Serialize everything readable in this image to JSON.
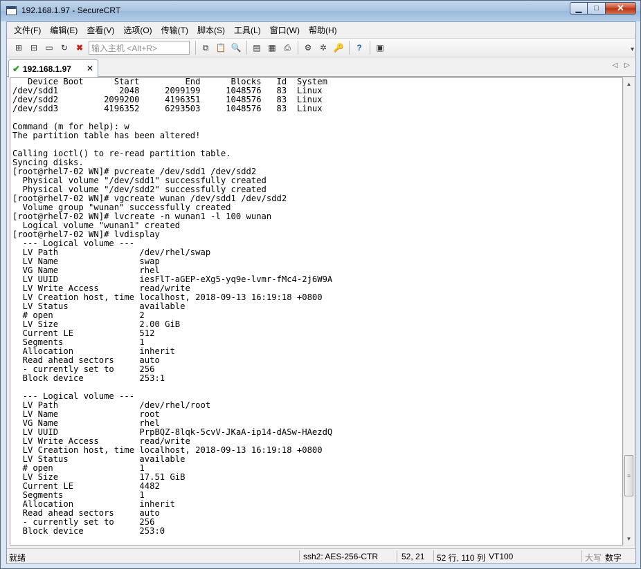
{
  "window": {
    "title": "192.168.1.97 - SecureCRT"
  },
  "menu": [
    "文件(F)",
    "编辑(E)",
    "查看(V)",
    "选项(O)",
    "传输(T)",
    "脚本(S)",
    "工具(L)",
    "窗口(W)",
    "帮助(H)"
  ],
  "toolbar": {
    "host_input_placeholder": "输入主机 <Alt+R>"
  },
  "tab": {
    "label": "192.168.1.97",
    "status": "connected"
  },
  "terminal": {
    "lines": [
      "   Device Boot      Start         End      Blocks   Id  System",
      "/dev/sdd1            2048     2099199     1048576   83  Linux",
      "/dev/sdd2         2099200     4196351     1048576   83  Linux",
      "/dev/sdd3         4196352     6293503     1048576   83  Linux",
      "",
      "Command (m for help): w",
      "The partition table has been altered!",
      "",
      "Calling ioctl() to re-read partition table.",
      "Syncing disks.",
      "[root@rhel7-02 WN]# pvcreate /dev/sdd1 /dev/sdd2",
      "  Physical volume \"/dev/sdd1\" successfully created",
      "  Physical volume \"/dev/sdd2\" successfully created",
      "[root@rhel7-02 WN]# vgcreate wunan /dev/sdd1 /dev/sdd2",
      "  Volume group \"wunan\" successfully created",
      "[root@rhel7-02 WN]# lvcreate -n wunan1 -l 100 wunan",
      "  Logical volume \"wunan1\" created",
      "[root@rhel7-02 WN]# lvdisplay",
      "  --- Logical volume ---",
      "  LV Path                /dev/rhel/swap",
      "  LV Name                swap",
      "  VG Name                rhel",
      "  LV UUID                iesFlT-aGEP-eXg5-yq9e-lvmr-fMc4-2j6W9A",
      "  LV Write Access        read/write",
      "  LV Creation host, time localhost, 2018-09-13 16:19:18 +0800",
      "  LV Status              available",
      "  # open                 2",
      "  LV Size                2.00 GiB",
      "  Current LE             512",
      "  Segments               1",
      "  Allocation             inherit",
      "  Read ahead sectors     auto",
      "  - currently set to     256",
      "  Block device           253:1",
      "",
      "  --- Logical volume ---",
      "  LV Path                /dev/rhel/root",
      "  LV Name                root",
      "  VG Name                rhel",
      "  LV UUID                PrpBQZ-8lqk-5cvV-JKaA-ip14-dASw-HAezdQ",
      "  LV Write Access        read/write",
      "  LV Creation host, time localhost, 2018-09-13 16:19:18 +0800",
      "  LV Status              available",
      "  # open                 1",
      "  LV Size                17.51 GiB",
      "  Current LE             4482",
      "  Segments               1",
      "  Allocation             inherit",
      "  Read ahead sectors     auto",
      "  - currently set to     256",
      "  Block device           253:0"
    ]
  },
  "status": {
    "ready": "就绪",
    "connection": "ssh2: AES-256-CTR",
    "cursor": "52,  21",
    "size": "52 行, 110 列",
    "terminal_type": "VT100",
    "caps": "大写",
    "num": "数字"
  }
}
